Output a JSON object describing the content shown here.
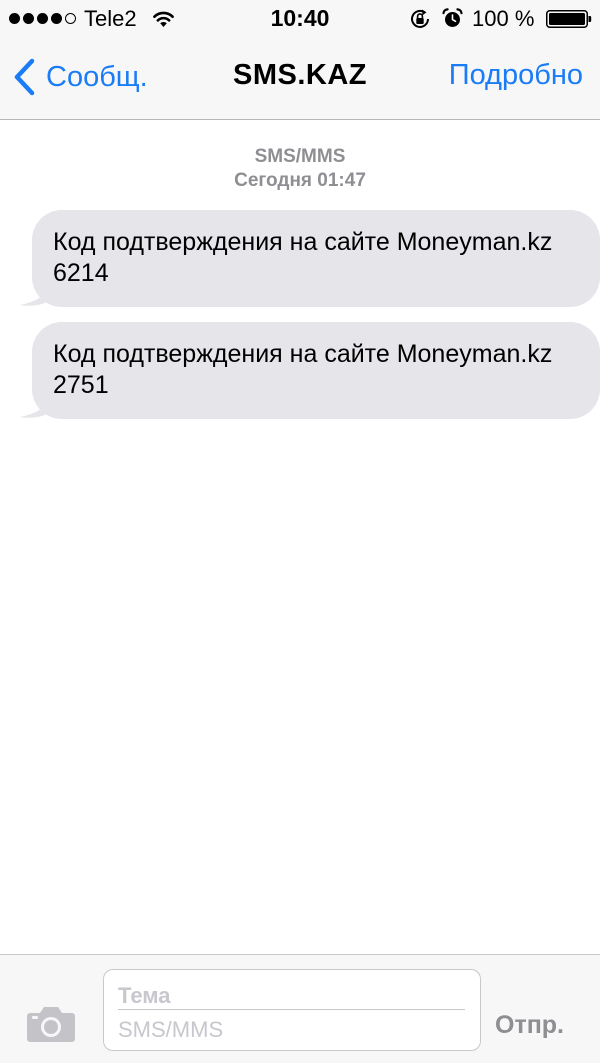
{
  "status_bar": {
    "carrier": "Tele2",
    "signal_bars_filled": 4,
    "signal_bars_total": 5,
    "time": "10:40",
    "battery_percent": "100 %",
    "icons": [
      "wifi-icon",
      "rotation-lock-icon",
      "alarm-icon",
      "battery-icon"
    ]
  },
  "nav": {
    "back_label": "Сообщ.",
    "title": "SMS.KAZ",
    "details_label": "Подробно"
  },
  "thread": {
    "service": "SMS/MMS",
    "timestamp": "Сегодня 01:47"
  },
  "messages": [
    {
      "direction": "incoming",
      "text": "Код подтверждения на сайте Moneyman.kz 6214"
    },
    {
      "direction": "incoming",
      "text": "Код подтверждения на сайте Moneyman.kz 2751"
    }
  ],
  "composer": {
    "subject_placeholder": "Тема",
    "message_placeholder": "SMS/MMS",
    "send_label": "Отпр.",
    "camera_icon": "camera-icon"
  },
  "colors": {
    "accent": "#1a7cf6",
    "bubble_incoming": "#e5e5ea",
    "secondary_text": "#8e8e93",
    "bar_background": "#f7f7f8"
  }
}
